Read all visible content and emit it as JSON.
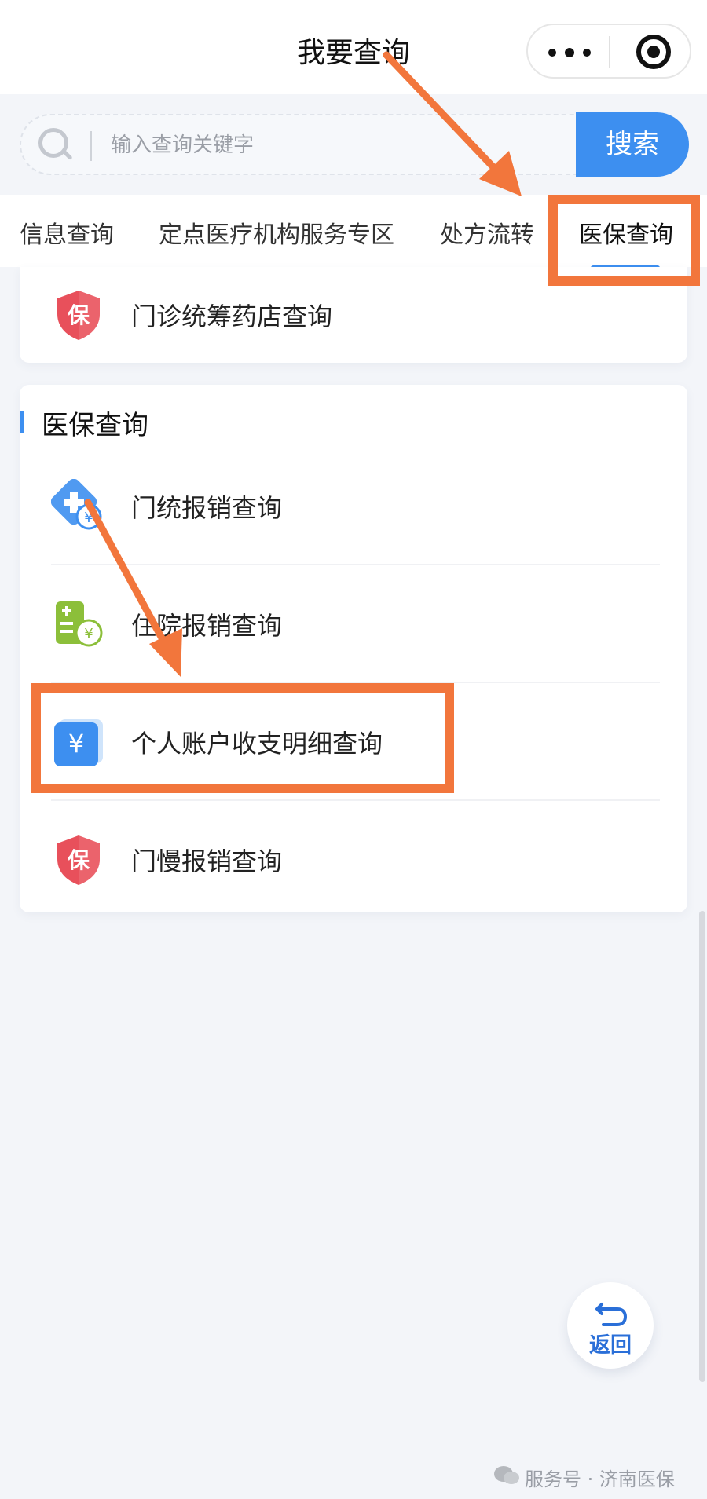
{
  "header": {
    "title": "我要查询"
  },
  "search": {
    "placeholder": "输入查询关键字",
    "button_label": "搜索"
  },
  "tabs": [
    {
      "label": "信息查询"
    },
    {
      "label": "定点医疗机构服务专区"
    },
    {
      "label": "处方流转"
    },
    {
      "label": "医保查询"
    }
  ],
  "top_card": {
    "item_label": "门诊统筹药店查询",
    "icon_glyph": "保"
  },
  "section": {
    "title": "医保查询",
    "items": [
      {
        "label": "门统报销查询",
        "icon": "medical-yuan-icon"
      },
      {
        "label": "住院报销查询",
        "icon": "hospital-bill-icon"
      },
      {
        "label": "个人账户收支明细查询",
        "icon": "account-yuan-icon"
      },
      {
        "label": "门慢报销查询",
        "icon": "shield-bao-icon"
      }
    ]
  },
  "icons": {
    "yuan": "¥",
    "bao": "保"
  },
  "back_button": {
    "label": "返回"
  },
  "watermark": {
    "text": "服务号 · 济南医保"
  },
  "colors": {
    "accent": "#3d8ff0",
    "annotation": "#f2763c",
    "shield": "#e8505b",
    "green": "#8cbf3a"
  }
}
